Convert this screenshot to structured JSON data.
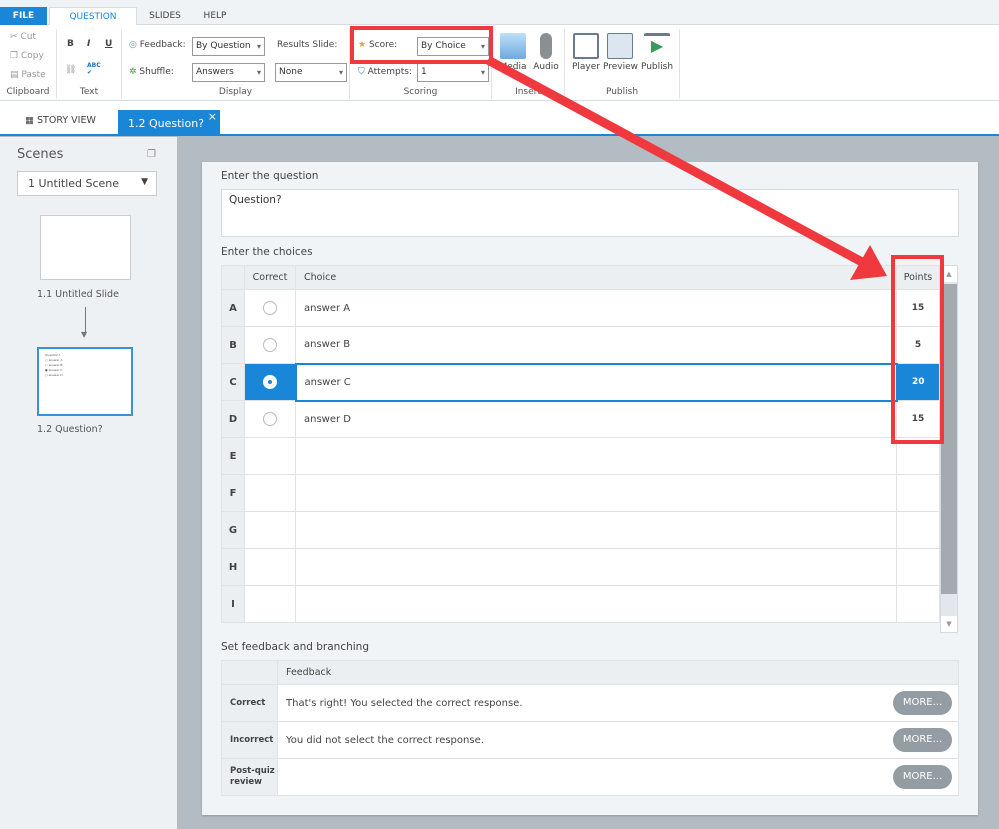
{
  "ribbon_tabs": [
    "FILE",
    "QUESTION",
    "SLIDES",
    "HELP"
  ],
  "clipboard": {
    "cut": "Cut",
    "copy": "Copy",
    "paste": "Paste",
    "label": "Clipboard"
  },
  "text_group": {
    "bold": "B",
    "italic": "I",
    "underline": "U",
    "spell": "ABC",
    "label": "Text"
  },
  "display": {
    "feedback_label": "Feedback:",
    "feedback_value": "By Question",
    "shuffle_label": "Shuffle:",
    "shuffle_value": "Answers",
    "results_label": "Results Slide:",
    "results_value": "None",
    "label": "Display"
  },
  "scoring": {
    "score_label": "Score:",
    "score_value": "By Choice",
    "attempts_label": "Attempts:",
    "attempts_value": "1",
    "label": "Scoring"
  },
  "insert": {
    "media": "Media",
    "audio": "Audio",
    "label": "Insert"
  },
  "publish": {
    "player": "Player",
    "preview": "Preview",
    "publish": "Publish",
    "label": "Publish"
  },
  "doc_tabs": {
    "story_view": "STORY VIEW",
    "active": "1.2 Question?",
    "close": "×"
  },
  "scenes": {
    "title": "Scenes",
    "selected": "1 Untitled Scene",
    "slides": [
      "1.1 Untitled Slide",
      "1.2 Question?"
    ]
  },
  "question": {
    "heading": "Enter the question",
    "value": "Question?"
  },
  "choices": {
    "heading": "Enter the choices",
    "headers": [
      "Correct",
      "Choice",
      "Points"
    ],
    "rows": [
      {
        "letter": "A",
        "choice": "answer A",
        "points": "15",
        "correct": false
      },
      {
        "letter": "B",
        "choice": "answer B",
        "points": "5",
        "correct": false
      },
      {
        "letter": "C",
        "choice": "answer C",
        "points": "20",
        "correct": true
      },
      {
        "letter": "D",
        "choice": "answer D",
        "points": "15",
        "correct": false
      },
      {
        "letter": "E",
        "choice": "",
        "points": ""
      },
      {
        "letter": "F",
        "choice": "",
        "points": ""
      },
      {
        "letter": "G",
        "choice": "",
        "points": ""
      },
      {
        "letter": "H",
        "choice": "",
        "points": ""
      },
      {
        "letter": "I",
        "choice": "",
        "points": ""
      }
    ]
  },
  "feedback": {
    "heading": "Set feedback and branching",
    "header": "Feedback",
    "rows": [
      {
        "label": "Correct",
        "text": "That's right!  You selected the correct response.",
        "button": "MORE..."
      },
      {
        "label": "Incorrect",
        "text": "You did not select the correct response.",
        "button": "MORE..."
      },
      {
        "label": "Post-quiz review",
        "text": "",
        "button": "MORE..."
      }
    ]
  },
  "colors": {
    "accent": "#1a86d8",
    "annotation": "#f0393f"
  }
}
